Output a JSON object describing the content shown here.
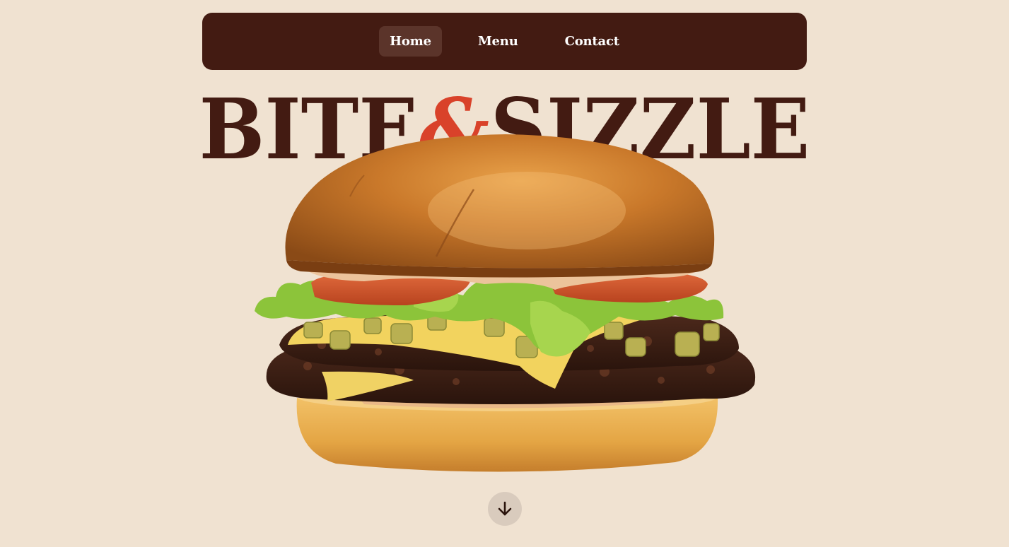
{
  "nav": {
    "items": [
      {
        "label": "Home",
        "active": true
      },
      {
        "label": "Menu",
        "active": false
      },
      {
        "label": "Contact",
        "active": false
      }
    ]
  },
  "brand": {
    "word1": "BITE",
    "ampersand": "&",
    "word2": "SIZZLE"
  },
  "hero": {
    "image": "burger-image"
  },
  "scroll": {
    "icon": "arrow-down-icon"
  },
  "colors": {
    "background": "#f0e2d1",
    "nav_bg": "#431b12",
    "nav_active_bg": "#5b342a",
    "brand_text": "#431b12",
    "accent": "#d9422a",
    "scroll_button": "#d9cbbd"
  }
}
